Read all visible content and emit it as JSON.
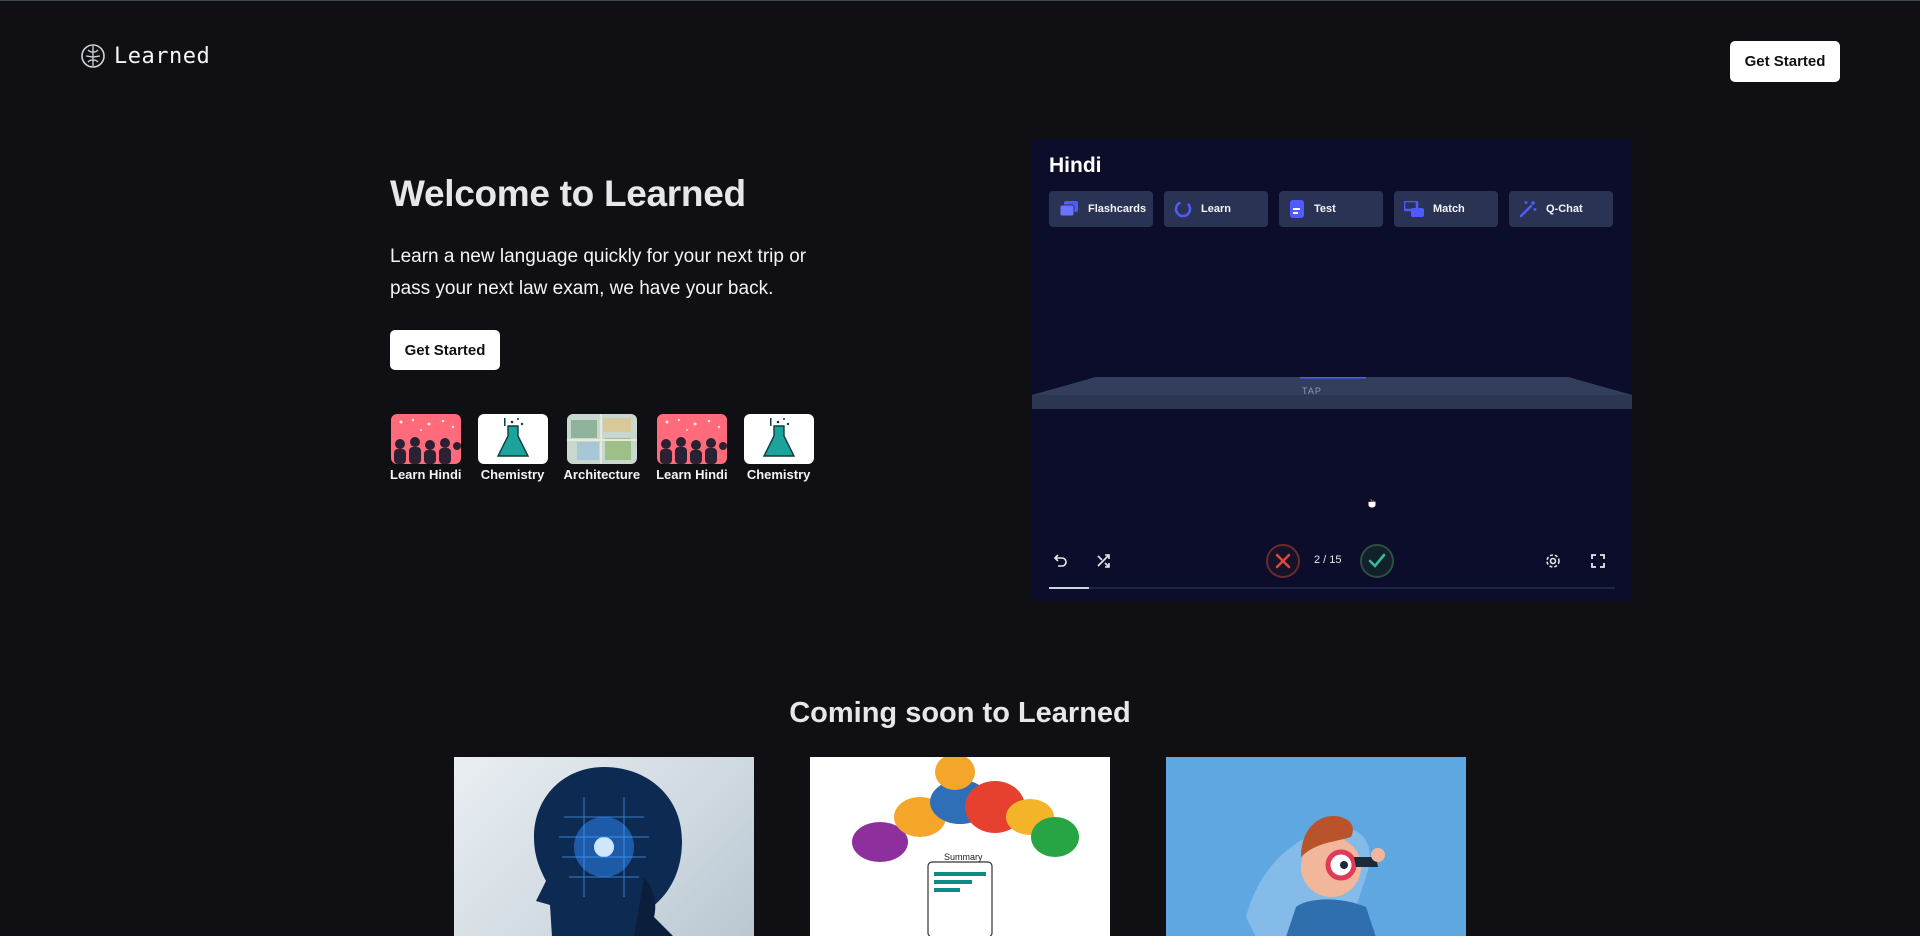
{
  "app": {
    "name": "Learned"
  },
  "nav": {
    "cta_label": "Get Started"
  },
  "hero": {
    "title": "Welcome to Learned",
    "subtitle": "Learn a new language quickly for your next trip or pass your next law exam, we have your back.",
    "cta_label": "Get Started"
  },
  "sets": [
    {
      "label": "Learn Hindi",
      "image": "hindi-people-illustration"
    },
    {
      "label": "Chemistry",
      "image": "chemistry-flask-illustration"
    },
    {
      "label": "Architecture",
      "image": "architecture-map-photo"
    },
    {
      "label": "Learn Hindi",
      "image": "hindi-people-illustration"
    },
    {
      "label": "Chemistry",
      "image": "chemistry-flask-illustration"
    }
  ],
  "preview": {
    "title": "Hindi",
    "modes": [
      {
        "label": "Flashcards",
        "icon": "cards-icon"
      },
      {
        "label": "Learn",
        "icon": "loop-icon"
      },
      {
        "label": "Test",
        "icon": "document-icon"
      },
      {
        "label": "Match",
        "icon": "match-icon"
      },
      {
        "label": "Q-Chat",
        "icon": "magic-wand-icon"
      }
    ],
    "card_hint": "TAP",
    "counter": "2 / 15",
    "progress": 0.07,
    "colors": {
      "wrong": "#e2483a",
      "right": "#2fbf9a",
      "accent": "#4f5bff"
    }
  },
  "coming_soon": {
    "title": "Coming soon to Learned",
    "features": [
      {
        "image": "ai-head-photo"
      },
      {
        "image": "summary-speech-bubbles-illustration",
        "caption": "Summary"
      },
      {
        "image": "magnifier-person-illustration"
      }
    ]
  }
}
